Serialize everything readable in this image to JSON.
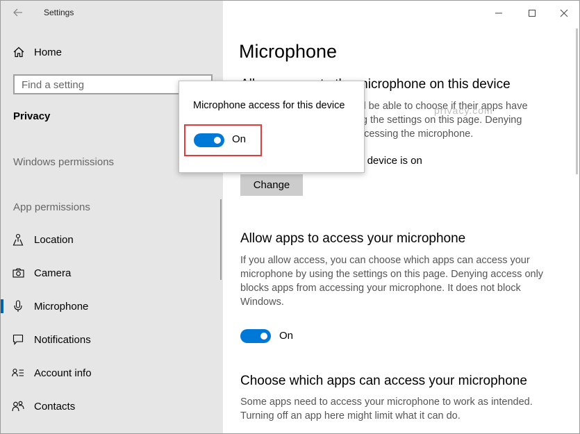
{
  "window": {
    "title": "Settings"
  },
  "sidebar": {
    "home_label": "Home",
    "search_placeholder": "Find a setting",
    "section": "Privacy",
    "groups": [
      "Windows permissions",
      "App permissions"
    ],
    "items": [
      {
        "label": "Location",
        "icon": "location-icon"
      },
      {
        "label": "Camera",
        "icon": "camera-icon"
      },
      {
        "label": "Microphone",
        "icon": "microphone-icon",
        "active": true
      },
      {
        "label": "Notifications",
        "icon": "notifications-icon"
      },
      {
        "label": "Account info",
        "icon": "account-info-icon"
      },
      {
        "label": "Contacts",
        "icon": "contacts-icon"
      }
    ]
  },
  "main": {
    "title": "Microphone",
    "device_section": {
      "heading": "Allow access to the microphone on this device",
      "desc": "People using this device will be able to choose if their apps have microphone access by using the settings on this page. Denying access blocks apps from accessing the microphone.",
      "status": "Microphone access for this device is on",
      "change_label": "Change"
    },
    "apps_section": {
      "heading": "Allow apps to access your microphone",
      "desc": "If you allow access, you can choose which apps can access your microphone by using the settings on this page. Denying access only blocks apps from accessing your microphone. It does not block Windows.",
      "toggle_label": "On",
      "toggle_on": true
    },
    "choose_section": {
      "heading": "Choose which apps can access your microphone",
      "desc": "Some apps need to access your microphone to work as intended. Turning off an app here might limit what it can do."
    },
    "watermark": "privacy.com"
  },
  "flyout": {
    "text": "Microphone access for this device",
    "toggle_label": "On",
    "toggle_on": true
  },
  "colors": {
    "accent": "#0078d7",
    "highlight": "#e03c3c",
    "sidebar_bg": "#e6e6e6"
  }
}
